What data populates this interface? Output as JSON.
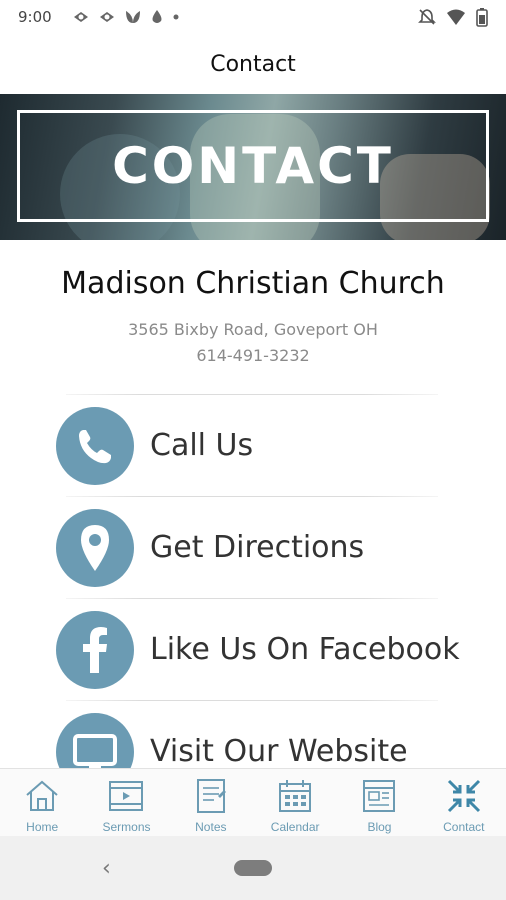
{
  "status_bar": {
    "time": "9:00",
    "left_icons": [
      "notification-icon",
      "notification-icon",
      "leaf-icon",
      "drop-icon",
      "dot-icon"
    ],
    "right_icons": [
      "mute-icon",
      "wifi-icon",
      "battery-icon"
    ]
  },
  "app_bar": {
    "title": "Contact"
  },
  "hero": {
    "title": "CONTACT"
  },
  "church": {
    "name": "Madison Christian Church",
    "address": "3565 Bixby Road, Goveport OH",
    "phone": "614-491-3232"
  },
  "actions": [
    {
      "label": "Call Us",
      "icon": "phone-icon"
    },
    {
      "label": "Get Directions",
      "icon": "map-pin-icon"
    },
    {
      "label": "Like Us On Facebook",
      "icon": "facebook-icon"
    },
    {
      "label": "Visit Our Website",
      "icon": "monitor-icon"
    }
  ],
  "tabs": [
    {
      "label": "Home",
      "icon": "home-icon"
    },
    {
      "label": "Sermons",
      "icon": "film-icon"
    },
    {
      "label": "Notes",
      "icon": "notes-icon"
    },
    {
      "label": "Calendar",
      "icon": "calendar-icon"
    },
    {
      "label": "Blog",
      "icon": "blog-icon"
    },
    {
      "label": "Contact",
      "icon": "contact-arrows-icon"
    }
  ],
  "colors": {
    "accent": "#6b9bb3",
    "text": "#111111",
    "muted": "#8a8a8a"
  }
}
